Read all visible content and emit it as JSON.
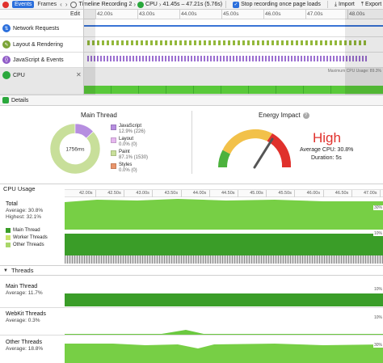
{
  "toolbar": {
    "tab_events": "Events",
    "tab_frames": "Frames",
    "back": "‹",
    "forward": "›",
    "recording_name": "Timeline Recording 2",
    "cpu_label": "CPU",
    "time_range": "41.45s – 47.21s (5.76s)",
    "stop_recording_label": "Stop recording once page loads",
    "import_label": "Import",
    "export_label": "Export"
  },
  "ruler": {
    "edit_label": "Edit",
    "ticks": [
      "42.00s",
      "43.00s",
      "44.00s",
      "45.00s",
      "46.00s",
      "47.00s",
      "48.00s"
    ]
  },
  "tracks": {
    "network": "Network Requests",
    "layout": "Layout & Rendering",
    "javascript": "JavaScript & Events",
    "cpu": "CPU",
    "max_cpu": "Maximum CPU Usage: 89.3%"
  },
  "details": {
    "label": "Details"
  },
  "main_thread": {
    "title": "Main Thread",
    "total": "1756ms",
    "legend": [
      {
        "name": "JavaScript",
        "stat": "12.9% (226)",
        "color": "#b68ee0",
        "fraction": 0.129
      },
      {
        "name": "Layout",
        "stat": "0.0% (0)",
        "color": "#e6b8ef",
        "fraction": 0.0
      },
      {
        "name": "Paint",
        "stat": "87.1% (1530)",
        "color": "#c8df9a",
        "fraction": 0.871
      },
      {
        "name": "Styles",
        "stat": "0.0% (0)",
        "color": "#e8956b",
        "fraction": 0.0
      }
    ]
  },
  "energy": {
    "title": "Energy Impact",
    "help": "?",
    "level": "High",
    "average": "Average CPU: 30.8%",
    "duration": "Duration: 5s"
  },
  "cpu_usage": {
    "title": "CPU Usage",
    "axis_ticks": [
      "42.00s",
      "42.50s",
      "43.00s",
      "43.50s",
      "44.00s",
      "44.50s",
      "45.00s",
      "45.50s",
      "46.00s",
      "46.50s",
      "47.00s"
    ],
    "total_name": "Total",
    "total_average": "Average: 30.8%",
    "total_highest": "Highest: 32.1%",
    "total_pct_top": "30%",
    "total_pct_mid": "10%",
    "legend": [
      {
        "name": "Main Thread",
        "color": "#3a9d28"
      },
      {
        "name": "Worker Threads",
        "color": "#c9e36b"
      },
      {
        "name": "Other Threads",
        "color": "#a9d66a"
      }
    ]
  },
  "threads": {
    "title": "Threads",
    "toggle": "▼",
    "rows": [
      {
        "name": "Main Thread",
        "average": "Average: 11.7%",
        "pct": "10%"
      },
      {
        "name": "WebKit Threads",
        "average": "Average: 0.3%",
        "pct": "10%"
      },
      {
        "name": "Other Threads",
        "average": "Average: 18.8%",
        "pct": "30%"
      }
    ]
  },
  "colors": {
    "accent_blue": "#2b6fdc",
    "cpu_green": "#59c93a",
    "energy_high": "#e0312c"
  }
}
